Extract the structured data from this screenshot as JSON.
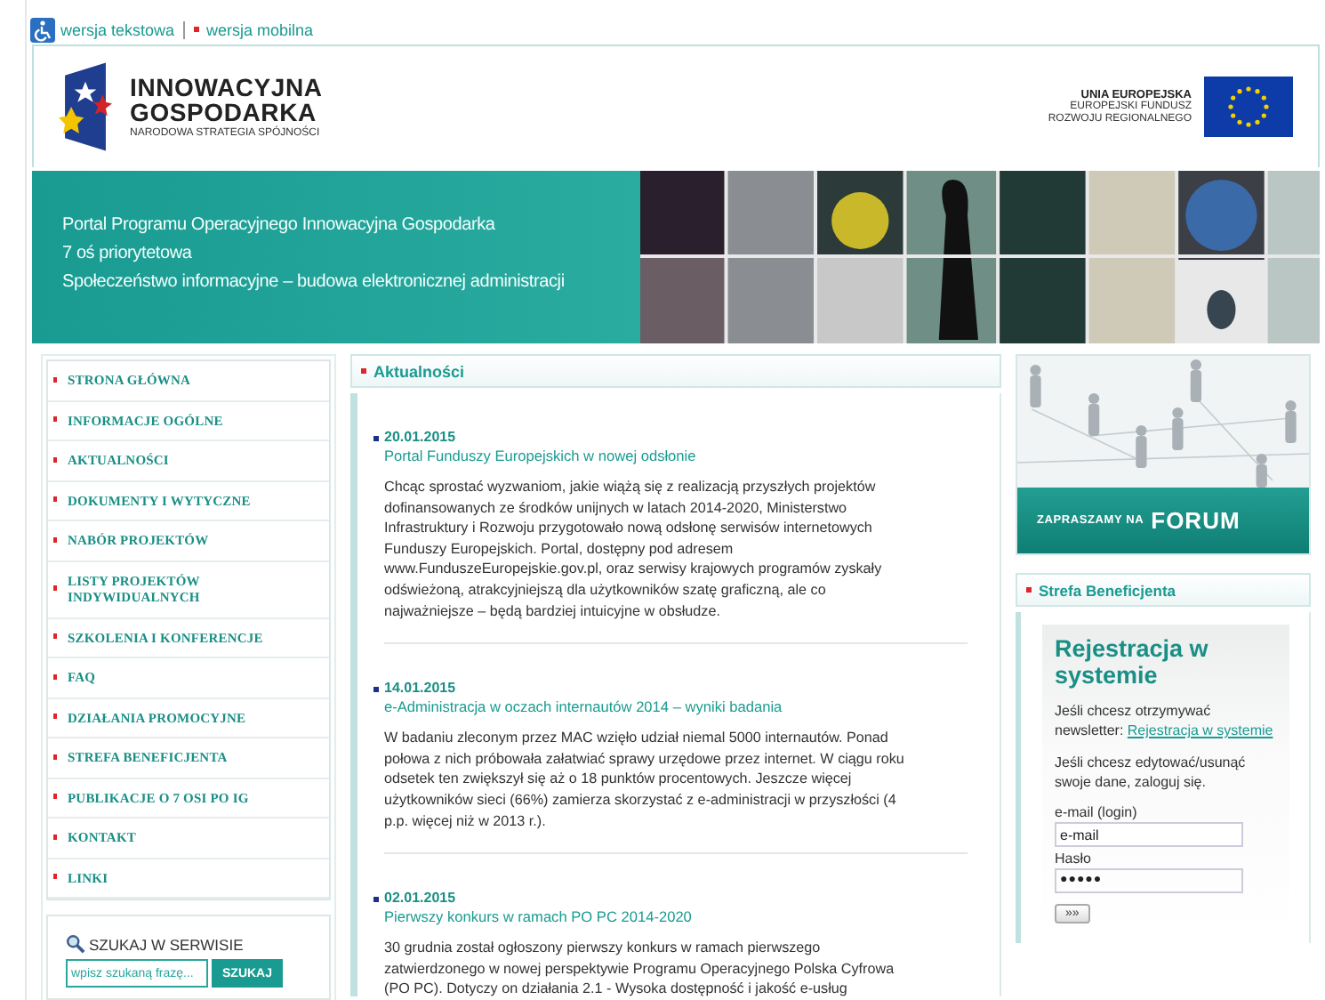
{
  "top_links": [
    "wersja tekstowa",
    "wersja mobilna"
  ],
  "header": {
    "logo_title": [
      "INNOWACYJNA",
      "GOSPODARKA"
    ],
    "logo_subtitle": "NARODOWA STRATEGIA SPÓJNOŚCI",
    "eu_title": "UNIA EUROPEJSKA",
    "eu_lines": [
      "EUROPEJSKI FUNDUSZ",
      "ROZWOJU REGIONALNEGO"
    ]
  },
  "banner": {
    "lines": [
      "Portal Programu Operacyjnego Innowacyjna Gospodarka",
      "7 oś priorytetowa",
      "Społeczeństwo informacyjne – budowa elektronicznej administracji"
    ]
  },
  "menu": {
    "items": [
      "STRONA GŁÓWNA",
      "INFORMACJE OGÓLNE",
      "AKTUALNOŚCI",
      "DOKUMENTY I WYTYCZNE",
      "NABÓR PROJEKTÓW",
      "LISTY PROJEKTÓW INDYWIDUALNYCH",
      "SZKOLENIA I KONFERENCJE",
      "FAQ",
      "DZIAŁANIA PROMOCYJNE",
      "STREFA BENEFICJENTA",
      "PUBLIKACJE O 7 OSI PO IG",
      "KONTAKT",
      "LINKI"
    ]
  },
  "search": {
    "title": "SZUKAJ W SERWISIE",
    "placeholder": "wpisz szukaną frazę...",
    "button": "SZUKAJ"
  },
  "news": {
    "title": "Aktualności",
    "items": [
      {
        "date": "20.01.2015",
        "title": "Portal Funduszy Europejskich w nowej odsłonie",
        "lines": [
          "Chcąc sprostać wyzwaniom, jakie wiążą się z realizacją przyszłych projektów",
          "dofinansowanych ze środków unijnych w latach 2014-2020, Ministerstwo",
          "Infrastruktury i Rozwoju przygotowało nową odsłonę serwisów internetowych",
          "Funduszy Europejskich. Portal, dostępny pod adresem",
          "www.FunduszeEuropejskie.gov.pl, oraz serwisy krajowych programów zyskały",
          "odświeżoną, atrakcyjniejszą dla użytkowników szatę graficzną, ale co",
          "najważniejsze – będą bardziej intuicyjne w obsłudze."
        ]
      },
      {
        "date": "14.01.2015",
        "title": "e-Administracja w oczach internautów 2014 – wyniki badania",
        "lines": [
          "W badaniu zleconym przez MAC wzięło udział niemal 5000 internautów. Ponad",
          "połowa z nich próbowała załatwiać sprawy urzędowe przez internet. W ciągu roku",
          "odsetek ten zwiększył się aż o 18 punktów procentowych. Jeszcze więcej",
          "użytkowników sieci (66%) zamierza skorzystać z e-administracji w przyszłości (4",
          "p.p. więcej niż w 2013 r.)."
        ]
      },
      {
        "date": "02.01.2015",
        "title": "Pierwszy konkurs w ramach PO PC 2014-2020",
        "lines": [
          "30 grudnia został ogłoszony pierwszy konkurs w ramach pierwszego",
          "zatwierdzonego w nowej perspektywie Programu Operacyjnego Polska Cyfrowa",
          "(PO PC). Dotyczy on działania 2.1 - Wysoka dostępność i jakość e-usług"
        ]
      }
    ]
  },
  "forum": {
    "small": "ZAPRASZAMY NA",
    "big": "FORUM"
  },
  "beneficiary": {
    "title": "Strefa Beneficjenta",
    "heading": "Rejestracja w systemie",
    "newsletter_text": "Jeśli chcesz otrzymywać newsletter:",
    "newsletter_link": "Rejestracja w systemie",
    "login_text": "Jeśli chcesz edytować/usunąć swoje dane, zaloguj się.",
    "email_label": "e-mail (login)",
    "email_value": "e-mail",
    "password_label": "Hasło",
    "password_value": "●●●●●",
    "submit": "»»"
  }
}
